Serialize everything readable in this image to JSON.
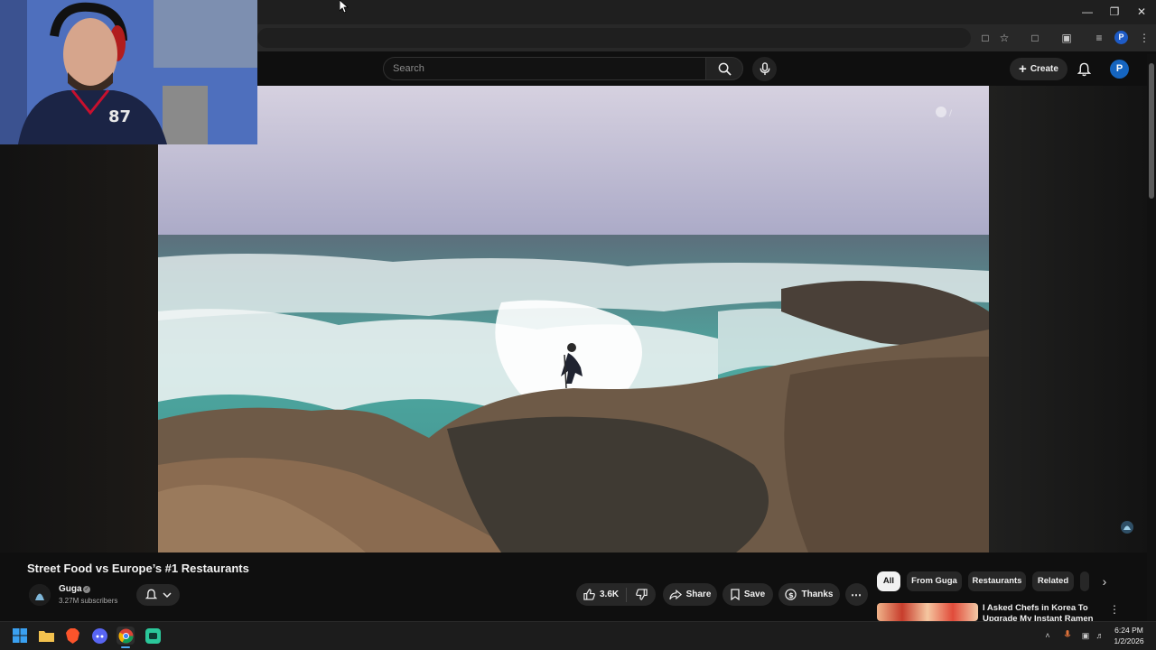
{
  "header": {
    "search_placeholder": "Search",
    "create_label": "Create",
    "profile_initial": "P"
  },
  "video": {
    "title": "Street Food vs Europe’s #1 Restaurants",
    "channel_name": "Guga",
    "subscribers": "3.27M subscribers",
    "like_count": "3.6K",
    "share_label": "Share",
    "save_label": "Save",
    "thanks_label": "Thanks"
  },
  "chips": [
    "All",
    "From Guga",
    "Restaurants",
    "Related"
  ],
  "recommended": {
    "title": "I Asked Chefs in Korea To Upgrade My Instant Ramen"
  },
  "taskbar": {
    "time": "6:24 PM",
    "date": "1/2/2026"
  },
  "colors": {
    "background": "#0f0f0f",
    "accent_blue": "#1565c0",
    "pill": "#272727"
  },
  "icons": [
    "search-icon",
    "mic-icon",
    "plus-icon",
    "bell-icon",
    "like-icon",
    "dislike-icon",
    "share-icon",
    "save-icon",
    "thanks-icon",
    "more-icon",
    "chevron-right-icon",
    "windows-start-icon",
    "file-explorer-icon",
    "brave-icon",
    "discord-icon",
    "chrome-icon",
    "app-icon"
  ]
}
